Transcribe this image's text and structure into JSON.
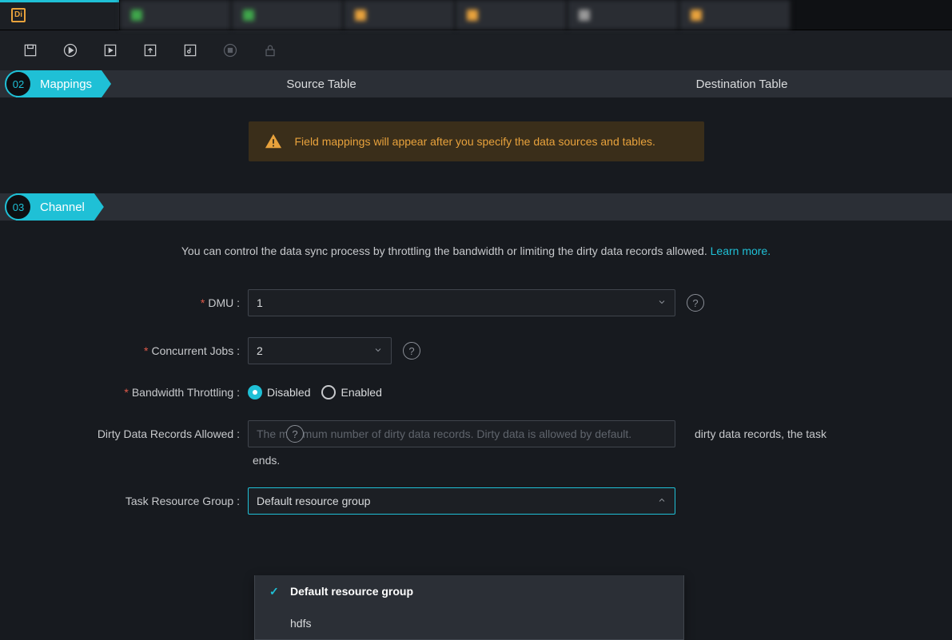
{
  "app_logo_text": "Di",
  "tabs": [
    {
      "label": ""
    },
    {
      "label": ""
    },
    {
      "label": ""
    },
    {
      "label": ""
    },
    {
      "label": ""
    },
    {
      "label": ""
    },
    {
      "label": ""
    }
  ],
  "sections": {
    "mappings": {
      "num": "02",
      "title": "Mappings",
      "col_left": "Source Table",
      "col_right": "Destination Table",
      "warning": "Field mappings will appear after you specify the data sources and tables."
    },
    "channel": {
      "num": "03",
      "title": "Channel",
      "description_pre": "You can control the data sync process by throttling the bandwidth or limiting the dirty data records allowed. ",
      "learn_more": "Learn more.",
      "fields": {
        "dmu": {
          "label": "DMU :",
          "value": "1"
        },
        "concurrent": {
          "label": "Concurrent Jobs :",
          "value": "2"
        },
        "throttling": {
          "label": "Bandwidth Throttling :",
          "opt_disabled": "Disabled",
          "opt_enabled": "Enabled"
        },
        "dirty": {
          "label": "Dirty Data Records Allowed :",
          "placeholder": "The maximum number of dirty data records. Dirty data is allowed by default.",
          "suffix": "dirty data records, the task",
          "suffix2": "ends."
        },
        "resource": {
          "label": "Task Resource Group :",
          "value": "Default resource group",
          "options": [
            "Default resource group",
            "hdfs"
          ]
        }
      }
    }
  }
}
